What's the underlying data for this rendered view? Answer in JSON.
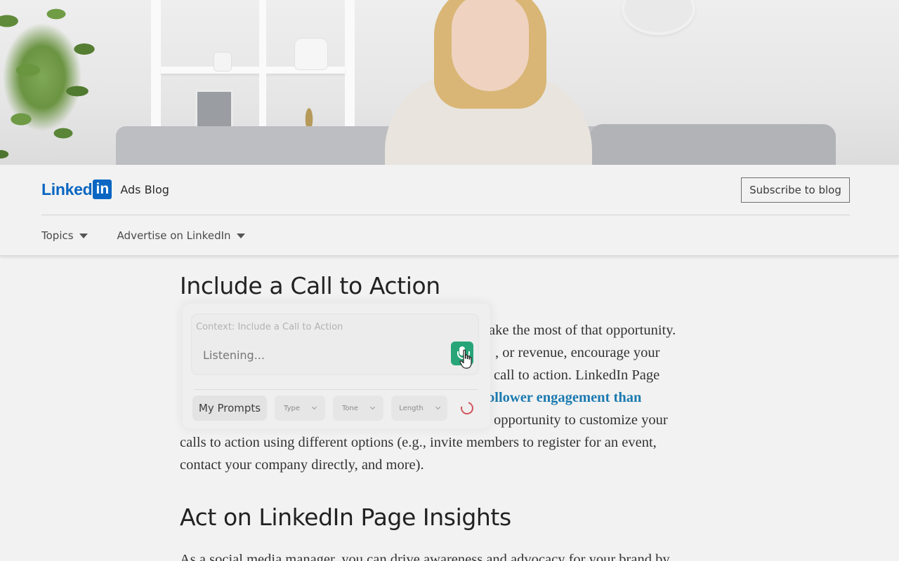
{
  "header": {
    "logo_word": "Linked",
    "logo_in": "in",
    "blog_name": "Ads Blog",
    "subscribe_label": "Subscribe to blog",
    "nav": [
      {
        "label": "Topics"
      },
      {
        "label": "Advertise on LinkedIn"
      }
    ]
  },
  "article": {
    "heading1": "Include a Call to Action",
    "para_lines": [
      "ake the most of that opportunity.",
      ", or revenue, encourage your",
      "call to action. LinkedIn Page",
      "ollower engagement than",
      "opportunity to customize your",
      "calls to action using different options (e.g., invite members to register for an event,",
      "contact your company directly, and more)."
    ],
    "heading2": "Act on LinkedIn Page Insights",
    "para2_line": "As a social media manager, you can drive awareness and advocacy for your brand by"
  },
  "widget": {
    "context_label": "Context: Include a Call to Action",
    "input_placeholder": "Listening...",
    "my_prompts_label": "My Prompts",
    "type_label": "Type",
    "tone_label": "Tone",
    "length_label": "Length",
    "mic_icon": "microphone-icon",
    "refresh_icon": "refresh-icon",
    "accent_color": "#27a578"
  },
  "colors": {
    "brand": "#0a66c2",
    "link": "#1b7ab0"
  }
}
